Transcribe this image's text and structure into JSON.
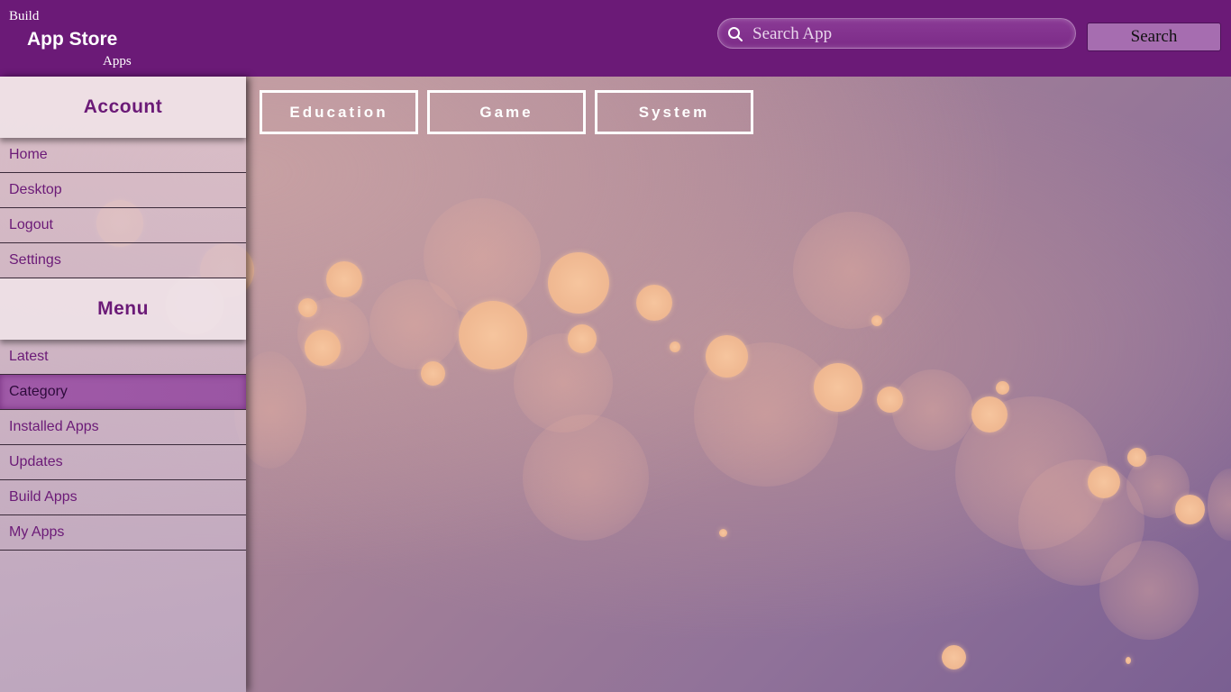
{
  "header": {
    "logo_line1": "Build",
    "logo_line2": "App Store",
    "logo_line3": "Apps",
    "search_placeholder": "Search App",
    "search_button_label": "Search",
    "search_icon": "search-icon"
  },
  "sidebar": {
    "account_title": "Account",
    "account_items": [
      {
        "label": "Home"
      },
      {
        "label": "Desktop"
      },
      {
        "label": "Logout"
      },
      {
        "label": "Settings"
      }
    ],
    "menu_title": "Menu",
    "menu_items": [
      {
        "label": "Latest"
      },
      {
        "label": "Category"
      },
      {
        "label": "Installed Apps"
      },
      {
        "label": "Updates"
      },
      {
        "label": "Build Apps"
      },
      {
        "label": "My Apps"
      }
    ],
    "active_item": "Category"
  },
  "categories": [
    {
      "label": "Education"
    },
    {
      "label": "Game"
    },
    {
      "label": "System"
    }
  ],
  "colors": {
    "brand": "#6b1a77",
    "active": "#a05aa8",
    "search_button": "#a66db0"
  }
}
